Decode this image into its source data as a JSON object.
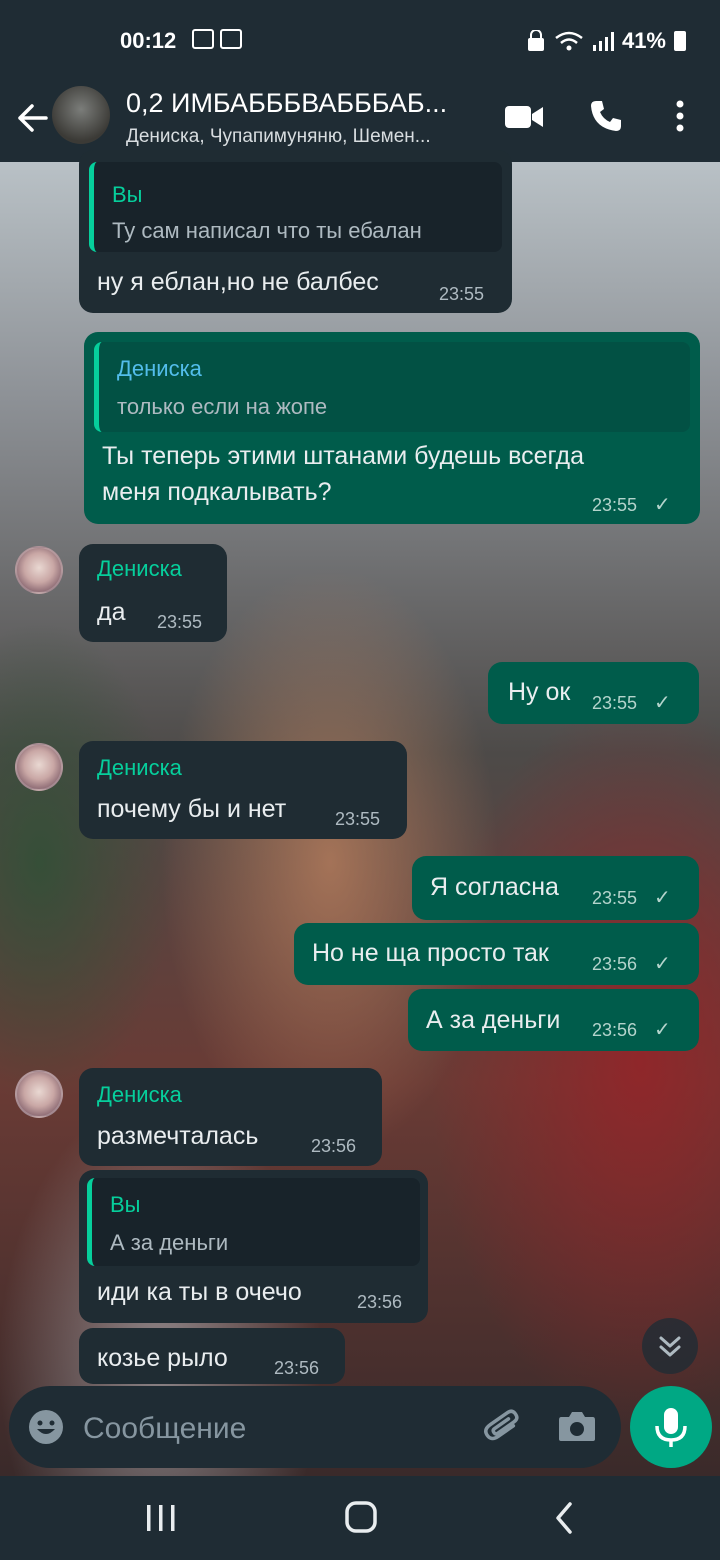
{
  "status_bar": {
    "time": "00:12",
    "battery": "41%"
  },
  "header": {
    "title": "0,2 ИМБАБББВАБББАБ...",
    "subtitle": "Дениска, Чупапимуняню, Шемен..."
  },
  "messages": [
    {
      "direction": "in",
      "quote_author": "Вы",
      "quote_text": "Ту сам написал что ты ебалан",
      "text": "ну я еблан,но не балбес",
      "time": "23:55"
    },
    {
      "direction": "out",
      "quote_author": "Дениска",
      "quote_text": "только если на жопе",
      "text_line1": "Ты теперь этими штанами будешь всегда",
      "text_line2": "меня подкалывать?",
      "time": "23:55",
      "status": "✓"
    },
    {
      "direction": "in",
      "sender": "Дениска",
      "text": "да",
      "time": "23:55"
    },
    {
      "direction": "out",
      "text": "Ну ок",
      "time": "23:55",
      "status": "✓"
    },
    {
      "direction": "in",
      "sender": "Дениска",
      "text": "почему бы и нет",
      "time": "23:55"
    },
    {
      "direction": "out",
      "text": "Я согласна",
      "time": "23:55",
      "status": "✓"
    },
    {
      "direction": "out",
      "text": "Но не ща просто так",
      "time": "23:56",
      "status": "✓"
    },
    {
      "direction": "out",
      "text": "А за деньги",
      "time": "23:56",
      "status": "✓"
    },
    {
      "direction": "in",
      "sender": "Дениска",
      "text": "размечталась",
      "time": "23:56"
    },
    {
      "direction": "in",
      "quote_author": "Вы",
      "quote_text": "А за деньги",
      "text": "иди ка ты в очечо",
      "time": "23:56"
    },
    {
      "direction": "in",
      "text": "козье рыло",
      "time": "23:56"
    }
  ],
  "composer": {
    "placeholder": "Сообщение"
  },
  "colors": {
    "incoming": "#1f2c33",
    "outgoing": "#005c4b",
    "accent": "#00a884",
    "bar": "#1f2c34"
  },
  "icons": [
    "back-arrow-icon",
    "video-call-icon",
    "phone-icon",
    "more-icon",
    "emoji-icon",
    "attach-icon",
    "camera-icon",
    "mic-icon",
    "scroll-down-icon",
    "recent-apps-icon",
    "home-icon",
    "nav-back-icon"
  ]
}
